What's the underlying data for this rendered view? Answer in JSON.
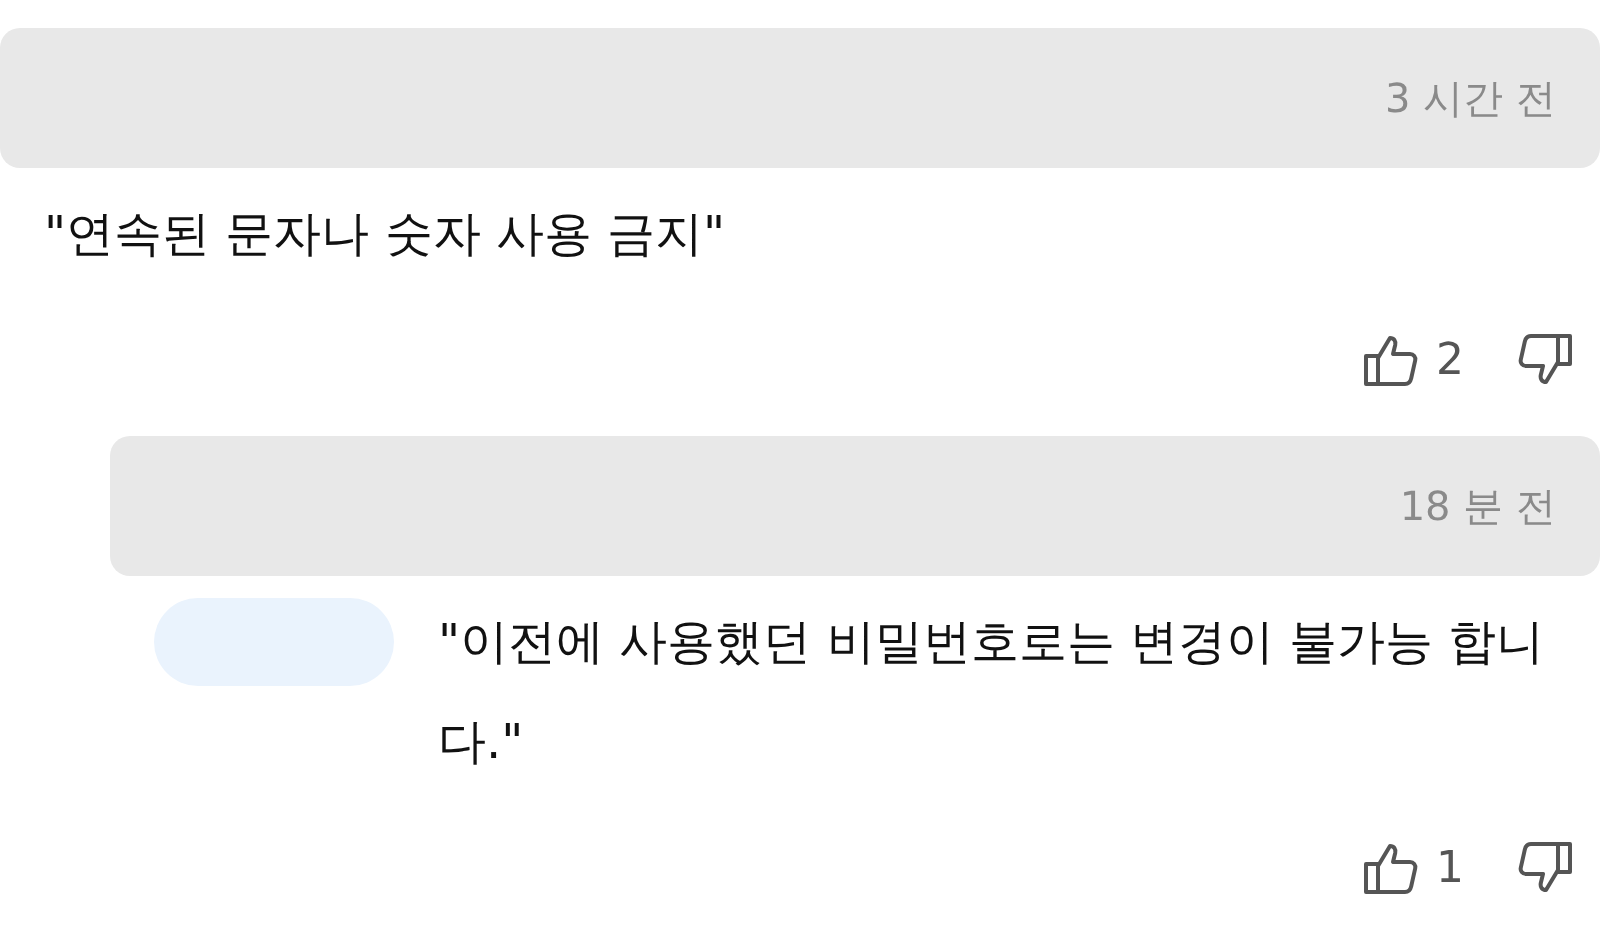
{
  "comments": [
    {
      "time": "3 시간 전",
      "text": "\"연속된 문자나 숫자 사용 금지\"",
      "likes": "2",
      "replies": [
        {
          "time": "18 분 전",
          "text": "\"이전에 사용했던 비밀번호로는 변경이 불가능 합니다.\"",
          "likes": "1",
          "mention": true
        }
      ]
    }
  ]
}
